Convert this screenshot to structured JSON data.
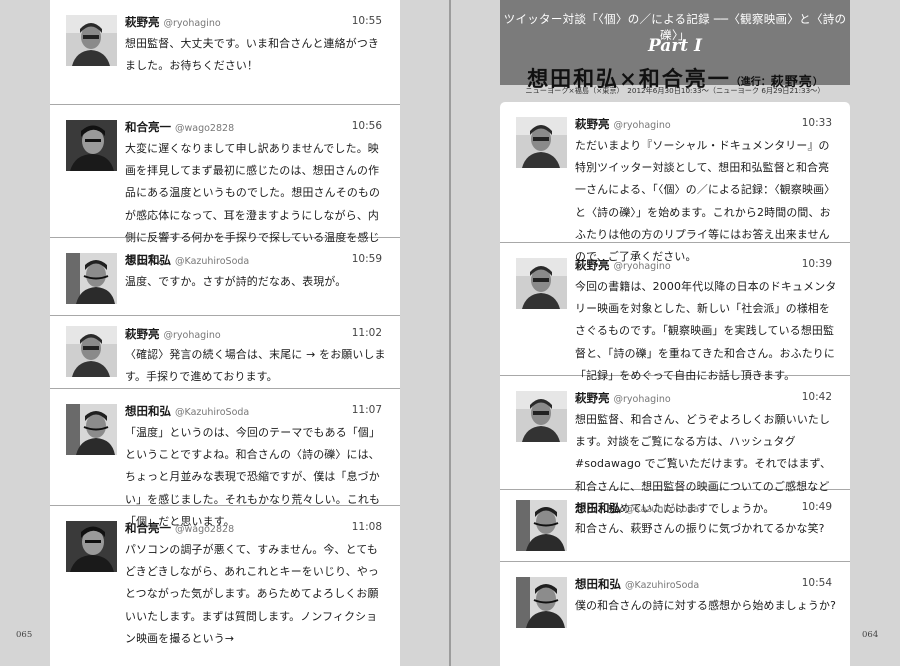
{
  "header": {
    "series_title": "ツイッター対談「〈個〉の／による記録 ──〈観察映画〉と〈詩の礫〉」",
    "part": "Part I",
    "main_title": "想田和弘×和合亮一",
    "host_label": "（進行：",
    "host_name": "萩野亮",
    "host_close": "）",
    "subtitle": "ニューヨーク×福島（×東京）　2012年6月30日10:33〜（ニューヨーク 6月29日21:33〜）"
  },
  "folios": {
    "left": "065",
    "right": "064"
  },
  "left_tweets": [
    {
      "name": "萩野亮",
      "handle": "@ryohagino",
      "time": "10:55",
      "text": "想田監督、大丈夫です。いま和合さんと連絡がつきました。お待ちください！",
      "avatar": "hagino"
    },
    {
      "name": "和合亮一",
      "handle": "@wago2828",
      "time": "10:56",
      "text": "大変に遅くなりまして申し訳ありませんでした。映画を拝見してまず最初に感じたのは、想田さんの作品にある温度というものでした。想田さんそのものが感応体になって、耳を澄ますようにしながら、内側に反響する何かを手探りで探している温度を感じました。",
      "avatar": "wago"
    },
    {
      "name": "想田和弘",
      "handle": "@KazuhiroSoda",
      "time": "10:59",
      "text": "温度、ですか。さすが詩的だなあ、表現が。",
      "avatar": "soda"
    },
    {
      "name": "萩野亮",
      "handle": "@ryohagino",
      "time": "11:02",
      "text": "〈確認〉発言の続く場合は、末尾に → をお願いします。手探りで進めております。",
      "avatar": "hagino"
    },
    {
      "name": "想田和弘",
      "handle": "@KazuhiroSoda",
      "time": "11:07",
      "text": "「温度」というのは、今回のテーマでもある「個」ということですよね。和合さんの〈詩の礫〉には、ちょっと月並みな表現で恐縮ですが、僕は「息づかい」を感じました。それもかなり荒々しい。これも「個」だと思います。",
      "avatar": "soda"
    },
    {
      "name": "和合亮一",
      "handle": "@wago2828",
      "time": "11:08",
      "text": "パソコンの調子が悪くて、すみません。今、とてもどきどきしながら、あれこれとキーをいじり、やっとつながった気がします。あらためてよろしくお願いいたします。まずは質問します。ノンフィクション映画を撮るという→",
      "avatar": "wago"
    }
  ],
  "right_tweets": [
    {
      "name": "萩野亮",
      "handle": "@ryohagino",
      "time": "10:33",
      "text": "ただいまより『ソーシャル・ドキュメンタリー』の特別ツイッター対談として、想田和弘監督と和合亮一さんによる、「〈個〉の／による記録：〈観察映画〉と〈詩の礫〉」を始めます。これから2時間の間、おふたりは他の方のリプライ等にはお答え出来ませんので、ご了承ください。",
      "avatar": "hagino"
    },
    {
      "name": "萩野亮",
      "handle": "@ryohagino",
      "time": "10:39",
      "text": "今回の書籍は、2000年代以降の日本のドキュメンタリー映画を対象とした、新しい「社会派」の様相をさぐるものです。「観察映画」を実践している想田監督と、「詩の礫」を重ねてきた和合さん。おふたりに「記録」をめぐって自由にお話し頂きます。",
      "avatar": "hagino"
    },
    {
      "name": "萩野亮",
      "handle": "@ryohagino",
      "time": "10:42",
      "text": "想田監督、和合さん、どうぞよろしくお願いいたします。対談をご覧になる方は、ハッシュタグ #sodawago でご覧いただけます。それではまず、和合さんに、想田監督の映画についてのご感想などから、始めていただけますでしょうか。",
      "avatar": "hagino"
    },
    {
      "name": "想田和弘",
      "handle": "@KazuhiroSoda",
      "time": "10:49",
      "text": "和合さん、萩野さんの振りに気づかれてるかな笑?",
      "avatar": "soda"
    },
    {
      "name": "想田和弘",
      "handle": "@KazuhiroSoda",
      "time": "10:54",
      "text": "僕の和合さんの詩に対する感想から始めましょうか?",
      "avatar": "soda"
    }
  ]
}
